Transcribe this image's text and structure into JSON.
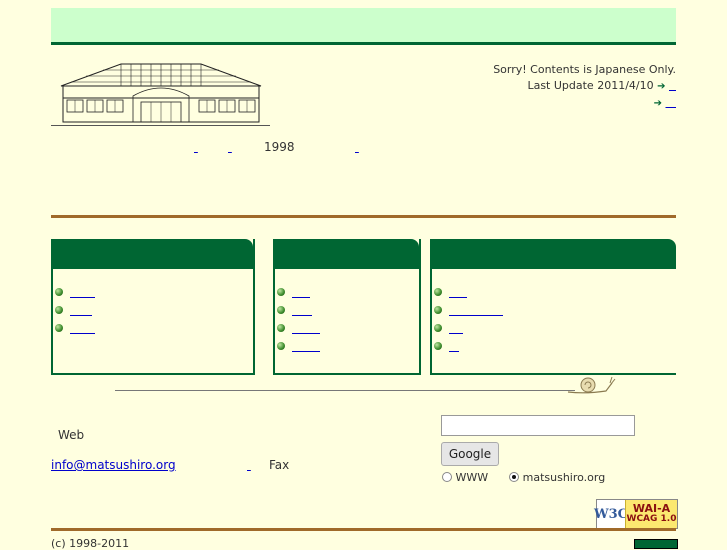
{
  "header": {
    "notice": "Sorry! Contents is Japanese Only.",
    "last_update": "Last Update 2011/4/10",
    "link_icon": "arrow-link-icon"
  },
  "intro": {
    "year": "1998"
  },
  "boxes": [
    {
      "items": 3
    },
    {
      "items": 4
    },
    {
      "items": 4
    }
  ],
  "contact": {
    "web_label": "Web",
    "email": "info@matsushiro.org",
    "fax_label": "Fax"
  },
  "search": {
    "value": "",
    "button_label": "Google",
    "options": [
      "WWW",
      "matsushiro.org"
    ],
    "selected": "matsushiro.org"
  },
  "wcag": {
    "logo": "W3C",
    "level": "WAI-A",
    "version": "WCAG 1.0"
  },
  "footer": {
    "copyright": "(c) 1998-2011"
  },
  "colors": {
    "accent": "#006633",
    "rule": "#a06a2a",
    "background": "#ffffe0",
    "topbar": "#ccffcc"
  }
}
